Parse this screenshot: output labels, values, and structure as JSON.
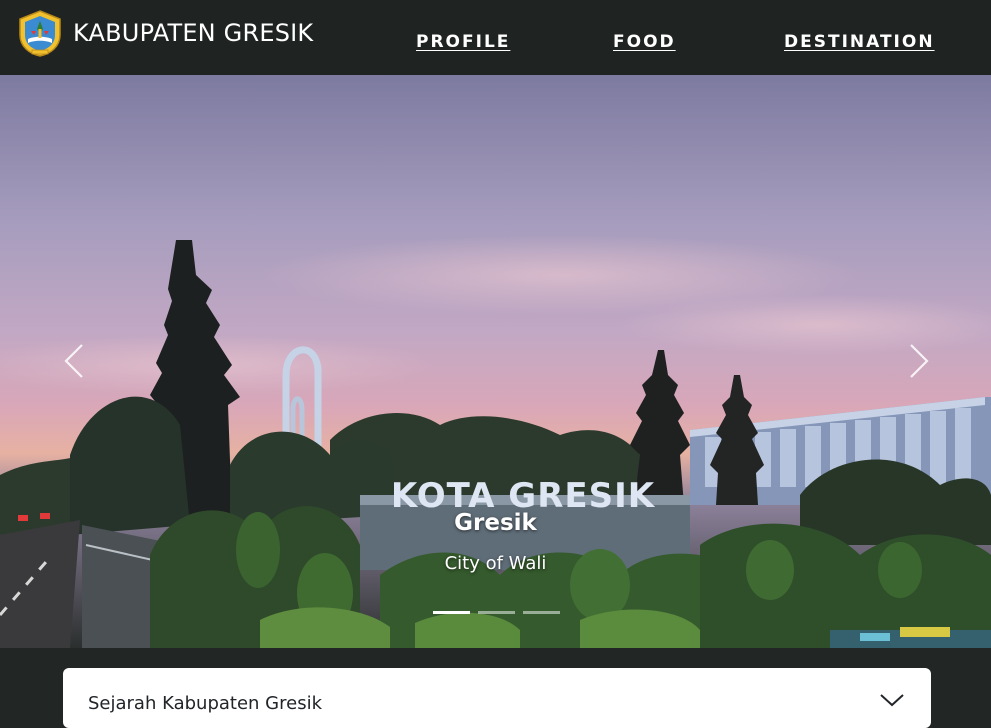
{
  "navbar": {
    "brand": "KABUPATEN GRESIK",
    "logo_icon": "gresik-regency-emblem-icon",
    "links": [
      "PROFILE",
      "FOOD",
      "DESTINATION"
    ]
  },
  "carousel": {
    "slides": [
      {
        "title": "Gresik",
        "subtitle": "City of Wali",
        "sign_text": "KOTA GRESIK",
        "image": "photo of the KOTA GRESIK landmark monument at dusk"
      }
    ],
    "slide_count": 3,
    "active_index": 0,
    "prev_icon": "chevron-left-icon",
    "next_icon": "chevron-right-icon"
  },
  "accordion": {
    "label": "Sejarah Kabupaten Gresik",
    "icon": "chevron-down-icon"
  },
  "colors": {
    "navbar_bg": "#1f2321",
    "page_bg": "#222624",
    "text_light": "#ffffff",
    "emblem_yellow": "#f2c12e"
  }
}
